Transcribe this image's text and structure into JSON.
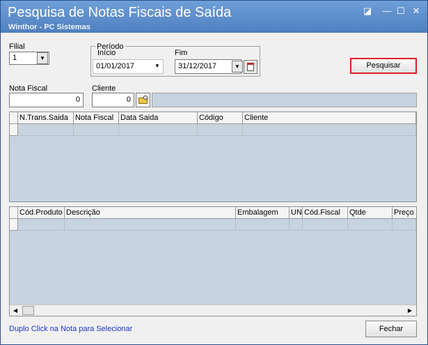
{
  "window": {
    "title": "Pesquisa de Notas Fiscais de Saída",
    "subtitle": "Winthor - PC Sistemas"
  },
  "filters": {
    "filial_label": "Filial",
    "filial_value": "1",
    "periodo_label": "Período",
    "inicio_label": "Início",
    "inicio_value": "01/01/2017",
    "fim_label": "Fim",
    "fim_value": "31/12/2017",
    "nota_fiscal_label": "Nota Fiscal",
    "nota_fiscal_value": "0",
    "cliente_label": "Cliente",
    "cliente_value": "0",
    "cliente_name_value": ""
  },
  "buttons": {
    "pesquisar": "Pesquisar",
    "fechar": "Fechar"
  },
  "grid_notas": {
    "columns": [
      "N.Trans.Saida",
      "Nota Fiscal",
      "Data Saida",
      "Código",
      "Cliente"
    ]
  },
  "grid_itens": {
    "columns": [
      "Cód.Produto",
      "Descrição",
      "Embalagem",
      "UN",
      "Cód.Fiscal",
      "Qtde",
      "Preço"
    ]
  },
  "status_text": "Duplo Click na Nota para Selecionar",
  "colors": {
    "title_bar": "#5b8ccb",
    "grid_background": "#c7d3df",
    "pesquisar_border": "#e02020",
    "status_text": "#1a35c8"
  },
  "icons": [
    "minimize-icon",
    "maximize-icon",
    "close-icon",
    "calendar-icon",
    "search-folder-icon",
    "chevron-down-icon",
    "scroll-left-icon",
    "scroll-right-icon"
  ]
}
